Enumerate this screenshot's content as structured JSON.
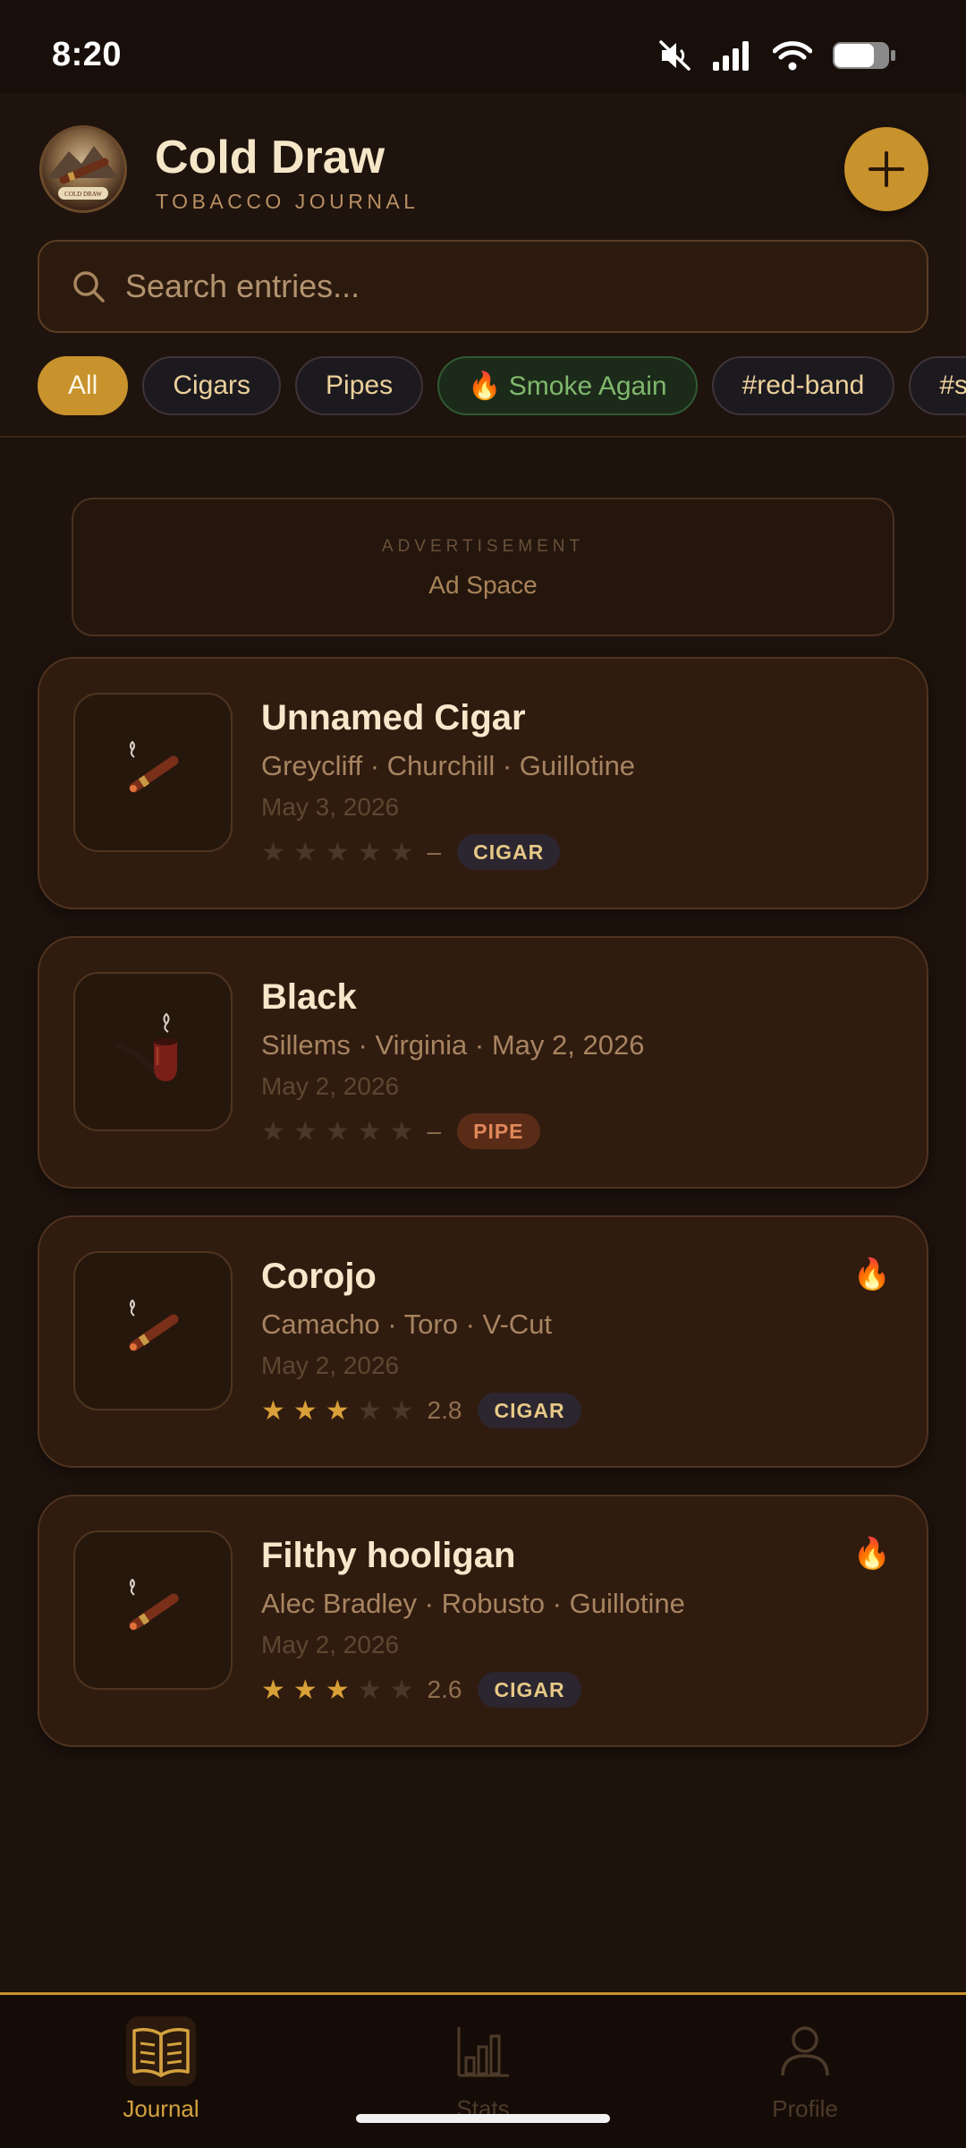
{
  "status_bar": {
    "time": "8:20"
  },
  "header": {
    "title": "Cold Draw",
    "subtitle": "TOBACCO JOURNAL",
    "avatar_text": "COLD DRAW"
  },
  "search": {
    "placeholder": "Search entries..."
  },
  "filters": [
    {
      "label": "All",
      "active": true
    },
    {
      "label": "Cigars",
      "active": false
    },
    {
      "label": "Pipes",
      "active": false
    },
    {
      "label": "🔥 Smoke Again",
      "active": false
    },
    {
      "label": "#red-band",
      "active": false
    },
    {
      "label": "#st-p",
      "active": false
    }
  ],
  "advertisement": {
    "label": "ADVERTISEMENT",
    "text": "Ad Space"
  },
  "entries": [
    {
      "title": "Unnamed Cigar",
      "subtitle": "Greycliff  · Churchill · Guillotine",
      "date": "May 3, 2026",
      "rating": 0,
      "score": "–",
      "type": "CIGAR",
      "smoke_again": false
    },
    {
      "title": "Black",
      "subtitle": "Sillems  · Virginia · May 2, 2026",
      "date": "May 2, 2026",
      "rating": 0,
      "score": "–",
      "type": "PIPE",
      "smoke_again": false
    },
    {
      "title": "Corojo",
      "subtitle": "Camacho  · Toro · V-Cut",
      "date": "May 2, 2026",
      "rating": 3,
      "score": "2.8",
      "type": "CIGAR",
      "smoke_again": true
    },
    {
      "title": "Filthy hooligan",
      "subtitle": "Alec Bradley  · Robusto · Guillotine",
      "date": "May 2, 2026",
      "rating": 3,
      "score": "2.6",
      "type": "CIGAR",
      "smoke_again": true
    }
  ],
  "nav": [
    {
      "label": "Journal",
      "icon": "book-icon",
      "active": true
    },
    {
      "label": "Stats",
      "icon": "bar-chart-icon",
      "active": false
    },
    {
      "label": "Profile",
      "icon": "person-icon",
      "active": false
    }
  ],
  "colors": {
    "accent": "#c8922c",
    "background": "#1d120c",
    "card": "#301b0f",
    "star_on": "#d9a038"
  }
}
